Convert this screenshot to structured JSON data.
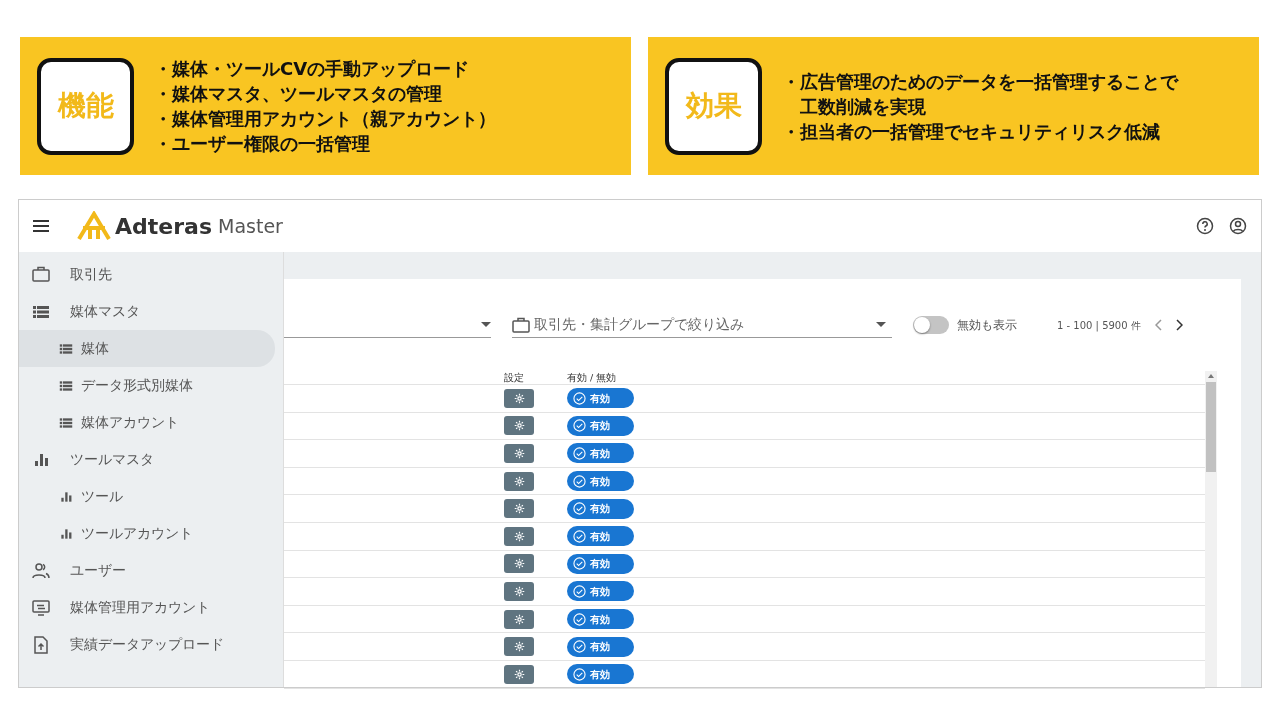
{
  "panels": [
    {
      "heading": "機能",
      "bullets": [
        "・媒体・ツールCVの手動アップロード",
        "・媒体マスタ、ツールマスタの管理",
        "・媒体管理用アカウント（親アカウント）",
        "・ユーザー権限の一括管理"
      ]
    },
    {
      "heading": "効果",
      "bullets": [
        "・広告管理のためのデータを一括管理することで工数削減を実現",
        "・担当者の一括管理でセキュリティリスク低減"
      ]
    }
  ],
  "app": {
    "header": {
      "brand": "Adteras",
      "product": "Master"
    },
    "sidebar": {
      "items": [
        {
          "label": "取引先",
          "kind": "briefcase",
          "selected": false
        },
        {
          "label": "媒体マスタ",
          "kind": "list",
          "selected": false,
          "children": [
            {
              "label": "媒体",
              "kind": "list",
              "selected": true
            },
            {
              "label": "データ形式別媒体",
              "kind": "list",
              "selected": false
            },
            {
              "label": "媒体アカウント",
              "kind": "list",
              "selected": false
            }
          ]
        },
        {
          "label": "ツールマスタ",
          "kind": "bars",
          "selected": false,
          "children": [
            {
              "label": "ツール",
              "kind": "bars",
              "selected": false
            },
            {
              "label": "ツールアカウント",
              "kind": "bars",
              "selected": false
            }
          ]
        },
        {
          "label": "ユーザー",
          "kind": "people",
          "selected": false
        },
        {
          "label": "媒体管理用アカウント",
          "kind": "monitor",
          "selected": false
        },
        {
          "label": "実績データアップロード",
          "kind": "upload",
          "selected": false
        }
      ]
    },
    "filter": {
      "placeholder": "取引先・集計グループで絞り込み"
    },
    "toggle": {
      "label": "無効も表示",
      "on": false
    },
    "pagination": "1 - 100 | 5900 件",
    "table": {
      "columns": [
        "設定",
        "有効 / 無効"
      ],
      "rows": [
        {
          "status": "有効",
          "enabled": true
        },
        {
          "status": "有効",
          "enabled": true
        },
        {
          "status": "有効",
          "enabled": true
        },
        {
          "status": "有効",
          "enabled": true
        },
        {
          "status": "有効",
          "enabled": true
        },
        {
          "status": "有効",
          "enabled": true
        },
        {
          "status": "有効",
          "enabled": true
        },
        {
          "status": "有効",
          "enabled": true
        },
        {
          "status": "有効",
          "enabled": true
        },
        {
          "status": "有効",
          "enabled": true
        },
        {
          "status": "有効",
          "enabled": true
        }
      ]
    }
  }
}
